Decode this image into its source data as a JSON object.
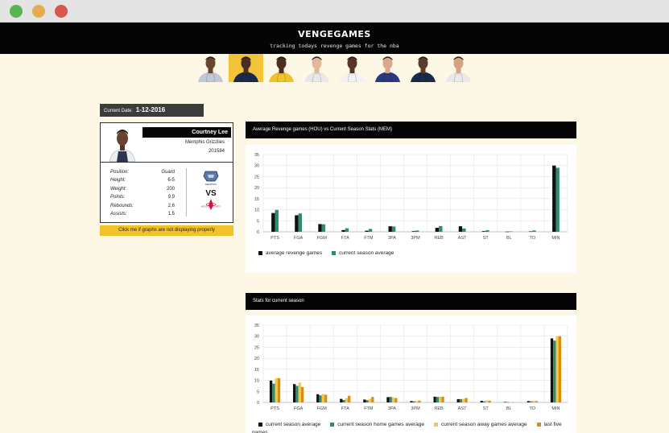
{
  "header": {
    "logo": "VENGEGAMES",
    "tagline": "tracking todays revenge games for the nba"
  },
  "players_strip": [
    {
      "jersey": "#bfc9d6",
      "skin": "#6b4430",
      "active": false
    },
    {
      "jersey": "#1b2a4a",
      "skin": "#4d2f22",
      "active": true
    },
    {
      "jersey": "#f0c32a",
      "skin": "#4b2e20",
      "active": false
    },
    {
      "jersey": "#e8e8e8",
      "skin": "#e2b79a",
      "active": false
    },
    {
      "jersey": "#f2f2f2",
      "skin": "#5a3525",
      "active": false
    },
    {
      "jersey": "#2a3a82",
      "skin": "#d8a98a",
      "active": false
    },
    {
      "jersey": "#1a2a4a",
      "skin": "#5e3b28",
      "active": false
    },
    {
      "jersey": "#e9e9e9",
      "skin": "#d3a384",
      "active": false
    }
  ],
  "current_date": {
    "label": "Current Date:",
    "value": "1-12-2016"
  },
  "player": {
    "name": "Courtney Lee",
    "team": "Memphis Grizzlies",
    "id": "201584",
    "stats": [
      {
        "label": "Position:",
        "value": "Guard"
      },
      {
        "label": "Height:",
        "value": "6-5"
      },
      {
        "label": "Weight:",
        "value": "200"
      },
      {
        "label": "Points:",
        "value": "9.9"
      },
      {
        "label": "Rebounds:",
        "value": "2.6"
      },
      {
        "label": "Assists:",
        "value": "1.5"
      }
    ],
    "vs_label": "VS",
    "team_logo_text": "MEMPHIS",
    "opponent_logo_text": "HOUSTON ROCKETS"
  },
  "help_button": "Click me if graphs are not displaying properly",
  "colors": {
    "black": "#111111",
    "green": "#2e8b6e",
    "yellow": "#f2c84b",
    "orange": "#de8a0b",
    "grid": "#e3e3e3"
  },
  "panels": [
    {
      "title": "Average Revenge games (HOU) vs Current Season Stats (MEM)"
    },
    {
      "title": "Stats for current season",
      "tail": "games"
    }
  ],
  "chart_data": [
    {
      "type": "bar",
      "title": "Average Revenge games (HOU) vs Current Season Stats (MEM)",
      "categories": [
        "PTS",
        "FGA",
        "FGM",
        "FTA",
        "FTM",
        "3PA",
        "3PM",
        "REB",
        "AST",
        "ST",
        "BL",
        "TO",
        "MIN"
      ],
      "series": [
        {
          "name": "average revenge games",
          "color": "#111111",
          "values": [
            8.5,
            7.5,
            3.5,
            0.8,
            0.5,
            2.5,
            0.3,
            1.8,
            2.5,
            0.3,
            0.1,
            0.2,
            30
          ]
        },
        {
          "name": "current season average",
          "color": "#2e8b6e",
          "values": [
            9.9,
            8.3,
            3.4,
            1.6,
            1.3,
            2.4,
            0.6,
            2.6,
            1.5,
            0.7,
            0.2,
            0.6,
            29
          ]
        }
      ],
      "yticks": [
        0,
        5,
        10,
        15,
        20,
        25,
        30,
        35
      ],
      "ylim": [
        0,
        35
      ],
      "legend": "bottom-left"
    },
    {
      "type": "bar",
      "title": "Stats for current season",
      "categories": [
        "PTS",
        "FGA",
        "FGM",
        "FTA",
        "FTM",
        "3PA",
        "3PM",
        "REB",
        "AST",
        "ST",
        "BL",
        "TO",
        "MIN"
      ],
      "series": [
        {
          "name": "current season average",
          "color": "#111111",
          "values": [
            9.9,
            8.3,
            3.7,
            1.6,
            1.3,
            2.4,
            0.6,
            2.6,
            1.5,
            0.7,
            0.2,
            0.6,
            29
          ]
        },
        {
          "name": "current season home games average",
          "color": "#2e8b6e",
          "values": [
            8.5,
            7.5,
            3.2,
            1.1,
            1.0,
            2.5,
            0.5,
            2.5,
            1.5,
            0.5,
            0.2,
            0.5,
            28
          ]
        },
        {
          "name": "current season away games average",
          "color": "#f2c84b",
          "values": [
            11,
            9,
            3.8,
            2.0,
            1.6,
            2.2,
            0.6,
            2.6,
            1.6,
            0.9,
            0.2,
            0.7,
            30
          ]
        },
        {
          "name": "last five",
          "color": "#de8a0b",
          "values": [
            11,
            7,
            3.5,
            3.0,
            2.5,
            2.0,
            0.8,
            2.6,
            2.0,
            0.8,
            0.1,
            0.6,
            30
          ]
        }
      ],
      "yticks": [
        0,
        5,
        10,
        15,
        20,
        25,
        30,
        35
      ],
      "ylim": [
        0,
        35
      ],
      "legend": "bottom-left"
    }
  ]
}
